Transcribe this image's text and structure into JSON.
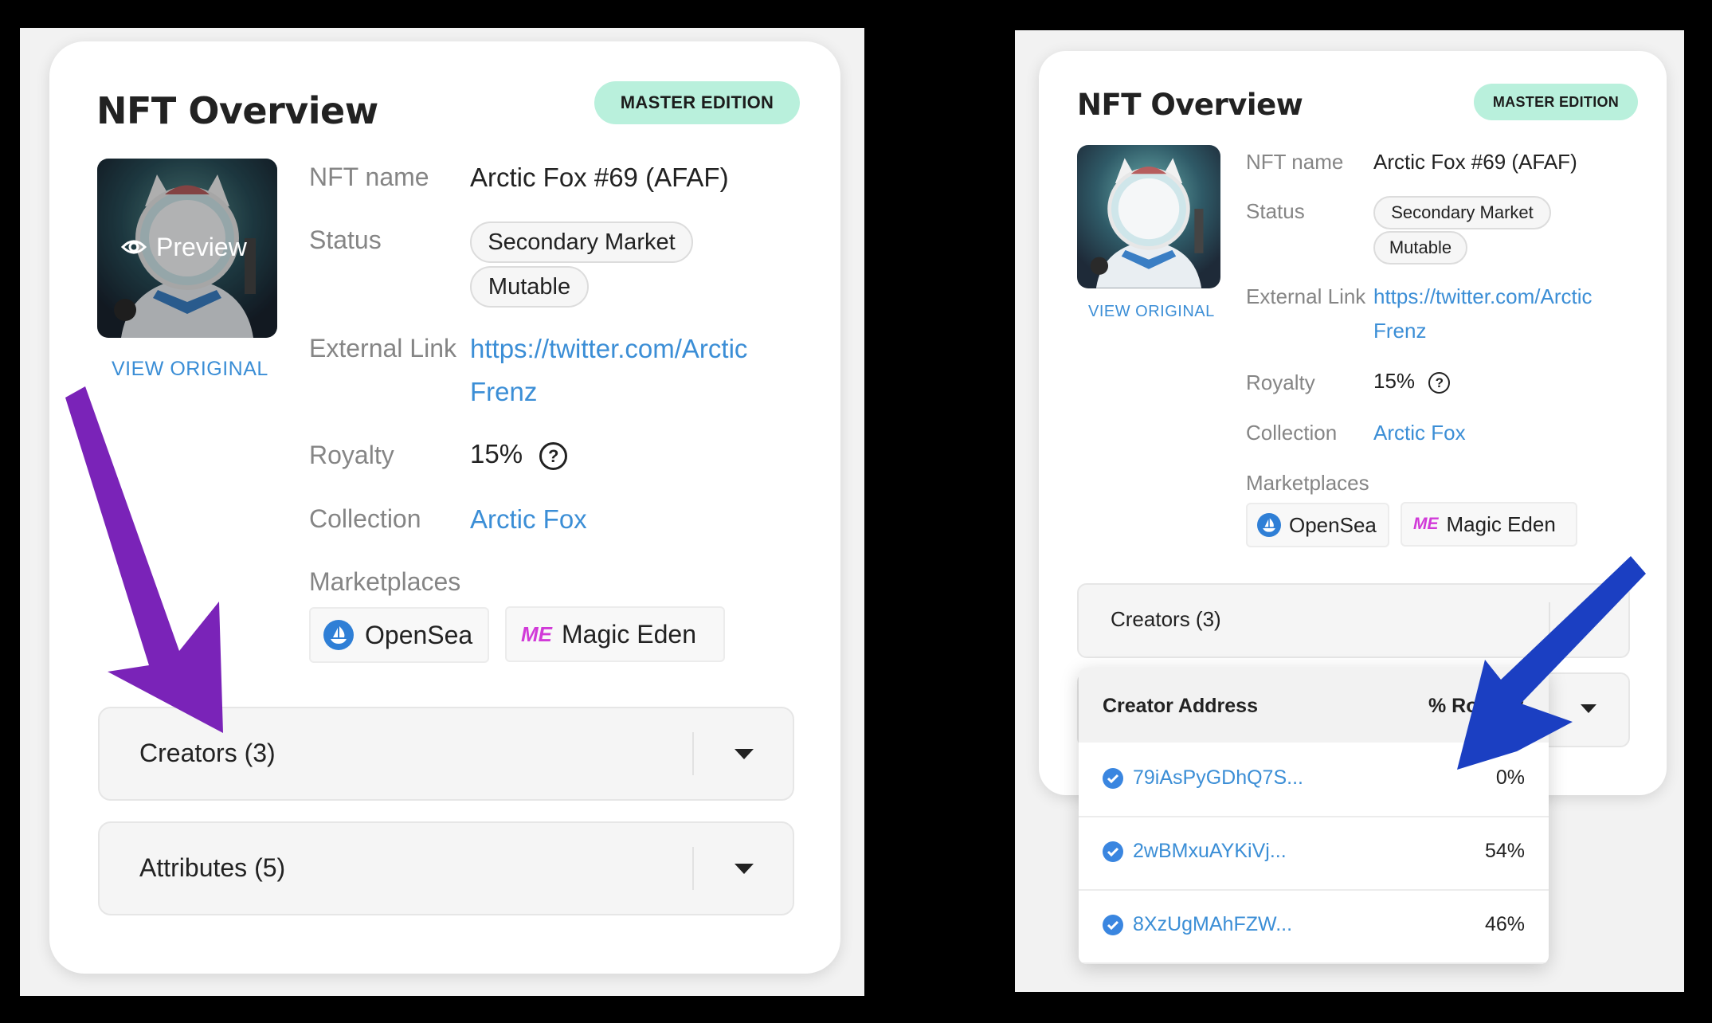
{
  "left": {
    "title": "NFT Overview",
    "badge": "MASTER EDITION",
    "preview": "Preview",
    "view_original": "VIEW ORIGINAL",
    "fields": {
      "name_label": "NFT name",
      "name_value": "Arctic Fox #69 (AFAF)",
      "status_label": "Status",
      "status_chips": [
        "Secondary Market",
        "Mutable"
      ],
      "link_label": "External Link",
      "link_line1": "https://twitter.com/Arctic",
      "link_line2": "Frenz",
      "royalty_label": "Royalty",
      "royalty_value": "15%",
      "collection_label": "Collection",
      "collection_value": "Arctic Fox",
      "marketplaces_label": "Marketplaces",
      "marketplaces": [
        "OpenSea",
        "Magic Eden"
      ]
    },
    "accordions": [
      "Creators (3)",
      "Attributes (5)"
    ],
    "arrow_color": "#7a23b8"
  },
  "right": {
    "title": "NFT Overview",
    "badge": "MASTER EDITION",
    "view_original": "VIEW ORIGINAL",
    "fields": {
      "name_label": "NFT name",
      "name_value": "Arctic Fox #69 (AFAF)",
      "status_label": "Status",
      "status_chips": [
        "Secondary Market",
        "Mutable"
      ],
      "link_label": "External Link",
      "link_line1": "https://twitter.com/Arctic",
      "link_line2": "Frenz",
      "royalty_label": "Royalty",
      "royalty_value": "15%",
      "collection_label": "Collection",
      "collection_value": "Arctic Fox",
      "marketplaces_label": "Marketplaces",
      "marketplaces": [
        "OpenSea",
        "Magic Eden"
      ]
    },
    "accordion": "Creators (3)",
    "table": {
      "col_address": "Creator Address",
      "col_royalty": "% Royalty",
      "rows": [
        {
          "address": "79iAsPyGDhQ7S...",
          "royalty": "0%"
        },
        {
          "address": "2wBMxuAYKiVj...",
          "royalty": "54%"
        },
        {
          "address": "8XzUgMAhFZW...",
          "royalty": "46%"
        }
      ]
    },
    "arrow_color": "#1b3fc2"
  }
}
